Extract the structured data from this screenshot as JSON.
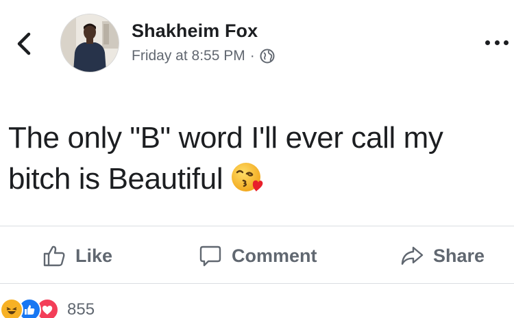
{
  "post": {
    "author": "Shakheim Fox",
    "time": "Friday at 8:55 PM",
    "separator": "·",
    "privacy_icon": "globe-icon",
    "text": "The only \"B\" word I'll ever call my bitch is Beautiful",
    "emoji": "face-blowing-a-kiss-emoji"
  },
  "header": {
    "back_icon": "chevron-left-icon",
    "more_icon": "more-options-icon"
  },
  "actions": {
    "like_label": "Like",
    "comment_label": "Comment",
    "share_label": "Share"
  },
  "reactions": {
    "icons": [
      "haha-icon",
      "like-icon",
      "love-icon"
    ],
    "count": "855"
  },
  "colors": {
    "text": "#1c1e21",
    "secondary_text": "#616770",
    "divider": "#dadde1",
    "like_blue": "#1877f2",
    "love_red": "#f33e58",
    "haha_yellow": "#f7b125"
  }
}
